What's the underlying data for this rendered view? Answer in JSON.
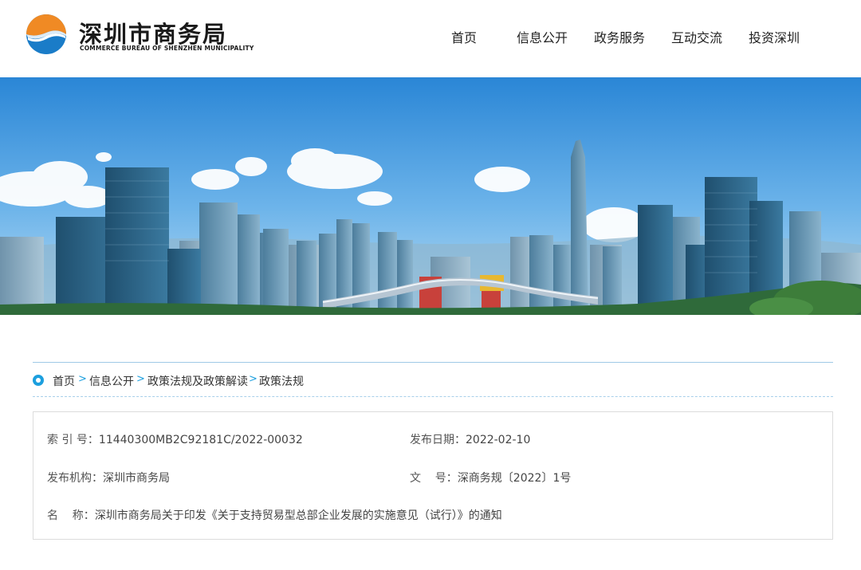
{
  "header": {
    "title_cn": "深圳市商务局",
    "title_en": "COMMERCE BUREAU OF SHENZHEN MUNICIPALITY",
    "nav": [
      {
        "label": "首页"
      },
      {
        "label": "信息公开"
      },
      {
        "label": "政务服务"
      },
      {
        "label": "互动交流"
      },
      {
        "label": "投资深圳"
      }
    ]
  },
  "breadcrumb": {
    "items": [
      "首页",
      "信息公开",
      "政策法规及政策解读",
      "政策法规"
    ],
    "separator": ">"
  },
  "info": {
    "index_label": "索 引 号：",
    "index_value": "11440300MB2C92181C/2022-00032",
    "date_label": "发布日期：",
    "date_value": "2022-02-10",
    "org_label": "发布机构：",
    "org_value": "深圳市商务局",
    "doc_label": "文    号：",
    "doc_value": "深商务规〔2022〕1号",
    "name_label": "名    称：",
    "name_value": "深圳市商务局关于印发《关于支持贸易型总部企业发展的实施意见（试行）》的通知"
  },
  "colors": {
    "accent": "#1c9fde",
    "logo_orange": "#f08a24",
    "logo_blue": "#1a7cc8"
  }
}
